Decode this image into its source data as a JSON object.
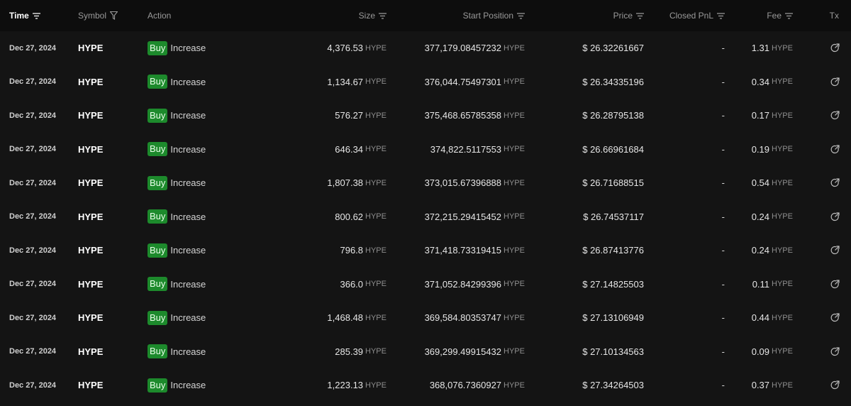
{
  "header": {
    "time": "Time",
    "symbol": "Symbol",
    "action": "Action",
    "size": "Size",
    "start_position": "Start Position",
    "price": "Price",
    "closed_pnl": "Closed PnL",
    "fee": "Fee",
    "tx": "Tx"
  },
  "colors": {
    "buy_badge": "#1d8a2c",
    "background": "#141414",
    "header_bg": "#0d0d0d"
  },
  "icons": {
    "sort": "sort-lines-icon",
    "filter": "filter-funnel-icon",
    "tx": "external-link-icon"
  },
  "rows": [
    {
      "time": "Dec 27, 2024",
      "symbol": "HYPE",
      "side": "Buy",
      "direction": "Increase",
      "size": "4,376.53",
      "size_unit": "HYPE",
      "start_position": "377,179.08457232",
      "start_unit": "HYPE",
      "price": "$ 26.32261667",
      "closed_pnl": "-",
      "fee": "1.31",
      "fee_unit": "HYPE"
    },
    {
      "time": "Dec 27, 2024",
      "symbol": "HYPE",
      "side": "Buy",
      "direction": "Increase",
      "size": "1,134.67",
      "size_unit": "HYPE",
      "start_position": "376,044.75497301",
      "start_unit": "HYPE",
      "price": "$ 26.34335196",
      "closed_pnl": "-",
      "fee": "0.34",
      "fee_unit": "HYPE"
    },
    {
      "time": "Dec 27, 2024",
      "symbol": "HYPE",
      "side": "Buy",
      "direction": "Increase",
      "size": "576.27",
      "size_unit": "HYPE",
      "start_position": "375,468.65785358",
      "start_unit": "HYPE",
      "price": "$ 26.28795138",
      "closed_pnl": "-",
      "fee": "0.17",
      "fee_unit": "HYPE"
    },
    {
      "time": "Dec 27, 2024",
      "symbol": "HYPE",
      "side": "Buy",
      "direction": "Increase",
      "size": "646.34",
      "size_unit": "HYPE",
      "start_position": "374,822.5117553",
      "start_unit": "HYPE",
      "price": "$ 26.66961684",
      "closed_pnl": "-",
      "fee": "0.19",
      "fee_unit": "HYPE"
    },
    {
      "time": "Dec 27, 2024",
      "symbol": "HYPE",
      "side": "Buy",
      "direction": "Increase",
      "size": "1,807.38",
      "size_unit": "HYPE",
      "start_position": "373,015.67396888",
      "start_unit": "HYPE",
      "price": "$ 26.71688515",
      "closed_pnl": "-",
      "fee": "0.54",
      "fee_unit": "HYPE"
    },
    {
      "time": "Dec 27, 2024",
      "symbol": "HYPE",
      "side": "Buy",
      "direction": "Increase",
      "size": "800.62",
      "size_unit": "HYPE",
      "start_position": "372,215.29415452",
      "start_unit": "HYPE",
      "price": "$ 26.74537117",
      "closed_pnl": "-",
      "fee": "0.24",
      "fee_unit": "HYPE"
    },
    {
      "time": "Dec 27, 2024",
      "symbol": "HYPE",
      "side": "Buy",
      "direction": "Increase",
      "size": "796.8",
      "size_unit": "HYPE",
      "start_position": "371,418.73319415",
      "start_unit": "HYPE",
      "price": "$ 26.87413776",
      "closed_pnl": "-",
      "fee": "0.24",
      "fee_unit": "HYPE"
    },
    {
      "time": "Dec 27, 2024",
      "symbol": "HYPE",
      "side": "Buy",
      "direction": "Increase",
      "size": "366.0",
      "size_unit": "HYPE",
      "start_position": "371,052.84299396",
      "start_unit": "HYPE",
      "price": "$ 27.14825503",
      "closed_pnl": "-",
      "fee": "0.11",
      "fee_unit": "HYPE"
    },
    {
      "time": "Dec 27, 2024",
      "symbol": "HYPE",
      "side": "Buy",
      "direction": "Increase",
      "size": "1,468.48",
      "size_unit": "HYPE",
      "start_position": "369,584.80353747",
      "start_unit": "HYPE",
      "price": "$ 27.13106949",
      "closed_pnl": "-",
      "fee": "0.44",
      "fee_unit": "HYPE"
    },
    {
      "time": "Dec 27, 2024",
      "symbol": "HYPE",
      "side": "Buy",
      "direction": "Increase",
      "size": "285.39",
      "size_unit": "HYPE",
      "start_position": "369,299.49915432",
      "start_unit": "HYPE",
      "price": "$ 27.10134563",
      "closed_pnl": "-",
      "fee": "0.09",
      "fee_unit": "HYPE"
    },
    {
      "time": "Dec 27, 2024",
      "symbol": "HYPE",
      "side": "Buy",
      "direction": "Increase",
      "size": "1,223.13",
      "size_unit": "HYPE",
      "start_position": "368,076.7360927",
      "start_unit": "HYPE",
      "price": "$ 27.34264503",
      "closed_pnl": "-",
      "fee": "0.37",
      "fee_unit": "HYPE"
    }
  ]
}
